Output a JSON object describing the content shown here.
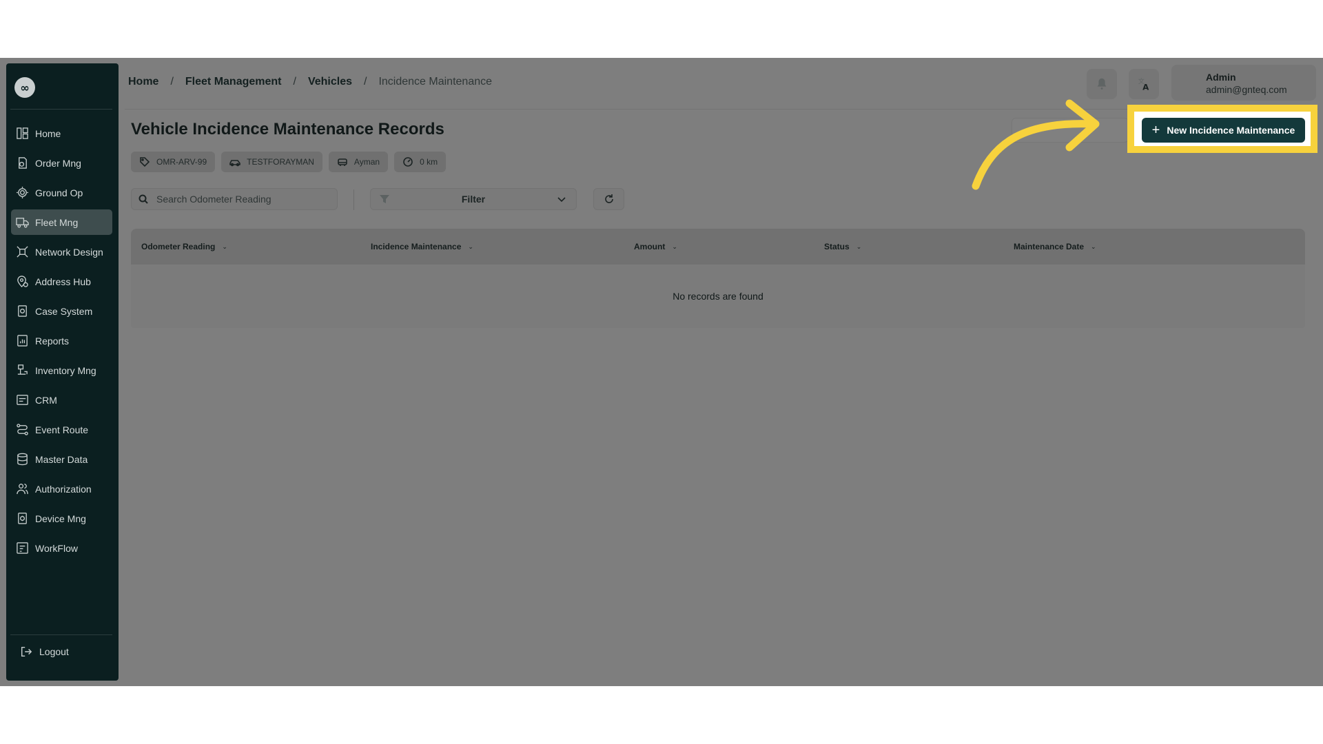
{
  "sidebar": {
    "items": [
      {
        "label": "Home",
        "icon": "home-icon"
      },
      {
        "label": "Order Mng",
        "icon": "order-icon"
      },
      {
        "label": "Ground Op",
        "icon": "ground-op-icon"
      },
      {
        "label": "Fleet Mng",
        "icon": "truck-icon",
        "active": true
      },
      {
        "label": "Network Design",
        "icon": "network-icon"
      },
      {
        "label": "Address Hub",
        "icon": "location-pin-icon"
      },
      {
        "label": "Case System",
        "icon": "case-icon"
      },
      {
        "label": "Reports",
        "icon": "report-icon"
      },
      {
        "label": "Inventory Mng",
        "icon": "inventory-icon"
      },
      {
        "label": "CRM",
        "icon": "crm-icon"
      },
      {
        "label": "Event Route",
        "icon": "route-icon"
      },
      {
        "label": "Master Data",
        "icon": "database-icon"
      },
      {
        "label": "Authorization",
        "icon": "users-icon"
      },
      {
        "label": "Device Mng",
        "icon": "device-icon"
      },
      {
        "label": "WorkFlow",
        "icon": "workflow-icon"
      }
    ],
    "logout_label": "Logout"
  },
  "breadcrumb": [
    "Home",
    "Fleet Management",
    "Vehicles",
    "Incidence Maintenance"
  ],
  "user": {
    "name": "Admin",
    "email": "admin@gnteq.com"
  },
  "page": {
    "title": "Vehicle Incidence Maintenance Records",
    "chips": [
      {
        "icon": "tag-icon",
        "label": "OMR-ARV-99"
      },
      {
        "icon": "car-icon",
        "label": "TESTFORAYMAN"
      },
      {
        "icon": "driver-icon",
        "label": "Ayman"
      },
      {
        "icon": "gauge-icon",
        "label": "0 km"
      }
    ],
    "new_button_label": "New Incidence Maintenance"
  },
  "toolbar": {
    "search_placeholder": "Search Odometer Reading",
    "filter_label": "Filter"
  },
  "table": {
    "columns": [
      "Odometer Reading",
      "Incidence Maintenance",
      "Amount",
      "Status",
      "Maintenance Date"
    ],
    "empty_text": "No records are found"
  },
  "colors": {
    "sidebar_bg": "#0b1f20",
    "primary_button": "#13393b",
    "highlight": "#f7d23d",
    "overlay": "#7e7e7e"
  }
}
